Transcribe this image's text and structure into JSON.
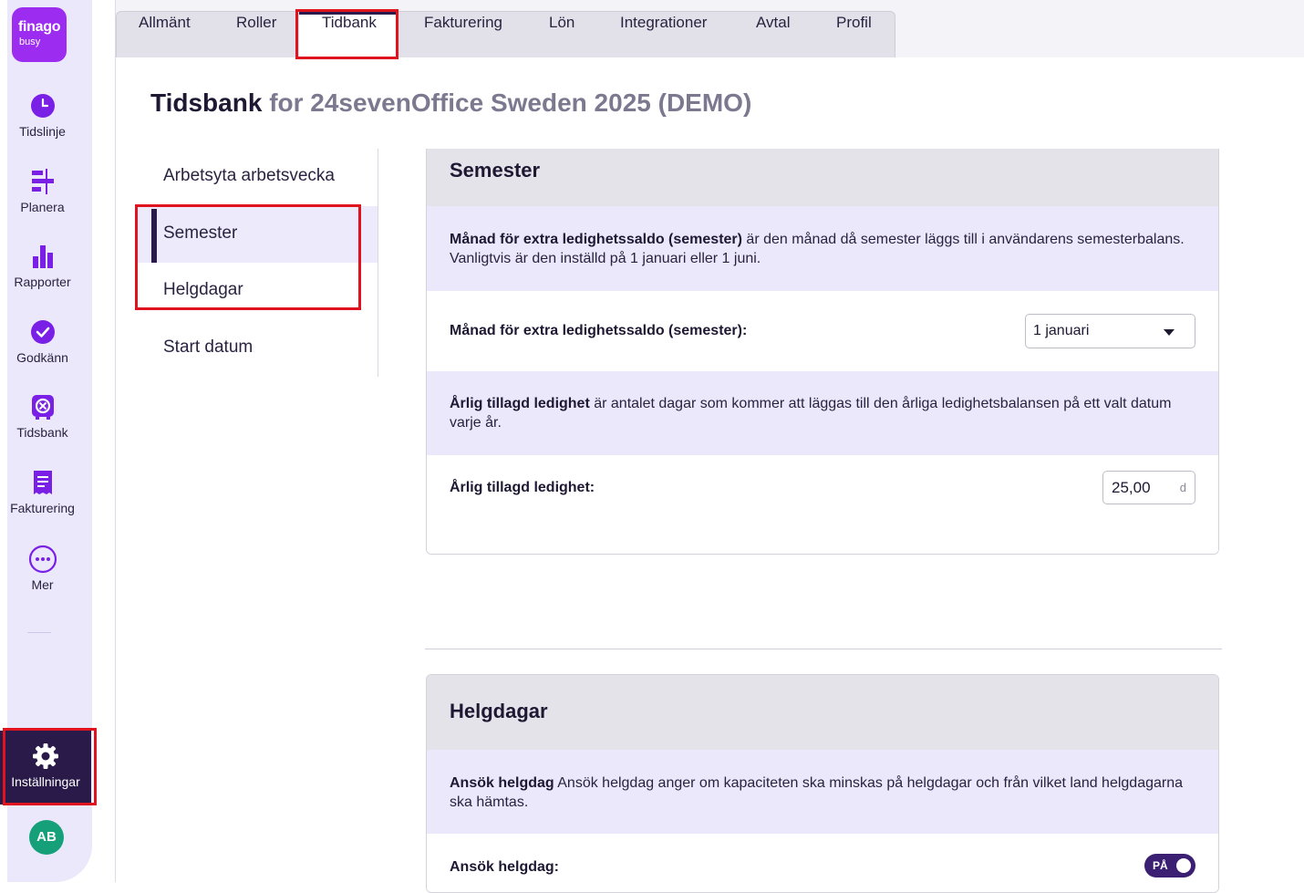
{
  "brand": {
    "name": "finago",
    "product": "busy"
  },
  "rail": {
    "items": [
      {
        "label": "Tidslinje",
        "icon": "clock-icon"
      },
      {
        "label": "Planera",
        "icon": "plan-icon"
      },
      {
        "label": "Rapporter",
        "icon": "bar-chart-icon"
      },
      {
        "label": "Godkänn",
        "icon": "check-circle-icon"
      },
      {
        "label": "Tidsbank",
        "icon": "timebank-icon"
      },
      {
        "label": "Fakturering",
        "icon": "invoice-icon"
      },
      {
        "label": "Mer",
        "icon": "more-icon"
      }
    ],
    "settings_label": "Inställningar",
    "avatar_initials": "AB"
  },
  "tabs": [
    {
      "label": "Allmänt"
    },
    {
      "label": "Roller"
    },
    {
      "label": "Tidbank",
      "active": true
    },
    {
      "label": "Fakturering"
    },
    {
      "label": "Lön"
    },
    {
      "label": "Integrationer"
    },
    {
      "label": "Avtal"
    },
    {
      "label": "Profil"
    }
  ],
  "page": {
    "title": "Tidsbank",
    "subtitle": "for 24sevenOffice Sweden 2025 (DEMO)"
  },
  "side_menu": {
    "items": [
      {
        "label": "Arbetsyta arbetsvecka"
      },
      {
        "label": "Semester",
        "active": true
      },
      {
        "label": "Helgdagar"
      },
      {
        "label": "Start datum"
      }
    ]
  },
  "semester": {
    "title": "Semester",
    "info1_bold": "Månad för extra ledighetssaldo (semester)",
    "info1_text": " är den månad då semester läggs till i användarens semesterbalans. Vanligtvis är den inställd på 1 januari eller 1 juni.",
    "month_label": "Månad för extra ledighetssaldo (semester):",
    "month_value": "1 januari",
    "info2_bold": "Årlig tillagd ledighet",
    "info2_text": " är antalet dagar som kommer att läggas till den årliga ledighetsbalansen på ett valt datum varje år.",
    "annual_label": "Årlig tillagd ledighet:",
    "annual_value": "25,00",
    "annual_unit": "d"
  },
  "helgdagar": {
    "title": "Helgdagar",
    "info_bold": "Ansök helgdag",
    "info_text": " Ansök helgdag anger om kapaciteten ska minskas på helgdagar och från vilket land helgdagarna ska hämtas.",
    "apply_label": "Ansök helgdag:",
    "toggle_text": "PÅ",
    "toggle_on": true
  },
  "colors": {
    "accent": "#2a1a4a",
    "brand": "#9b2cf0",
    "icon_purple": "#7a1fe6",
    "info_bg": "#ebe8fc",
    "highlight": "#e0141e",
    "avatar": "#16a07a"
  }
}
